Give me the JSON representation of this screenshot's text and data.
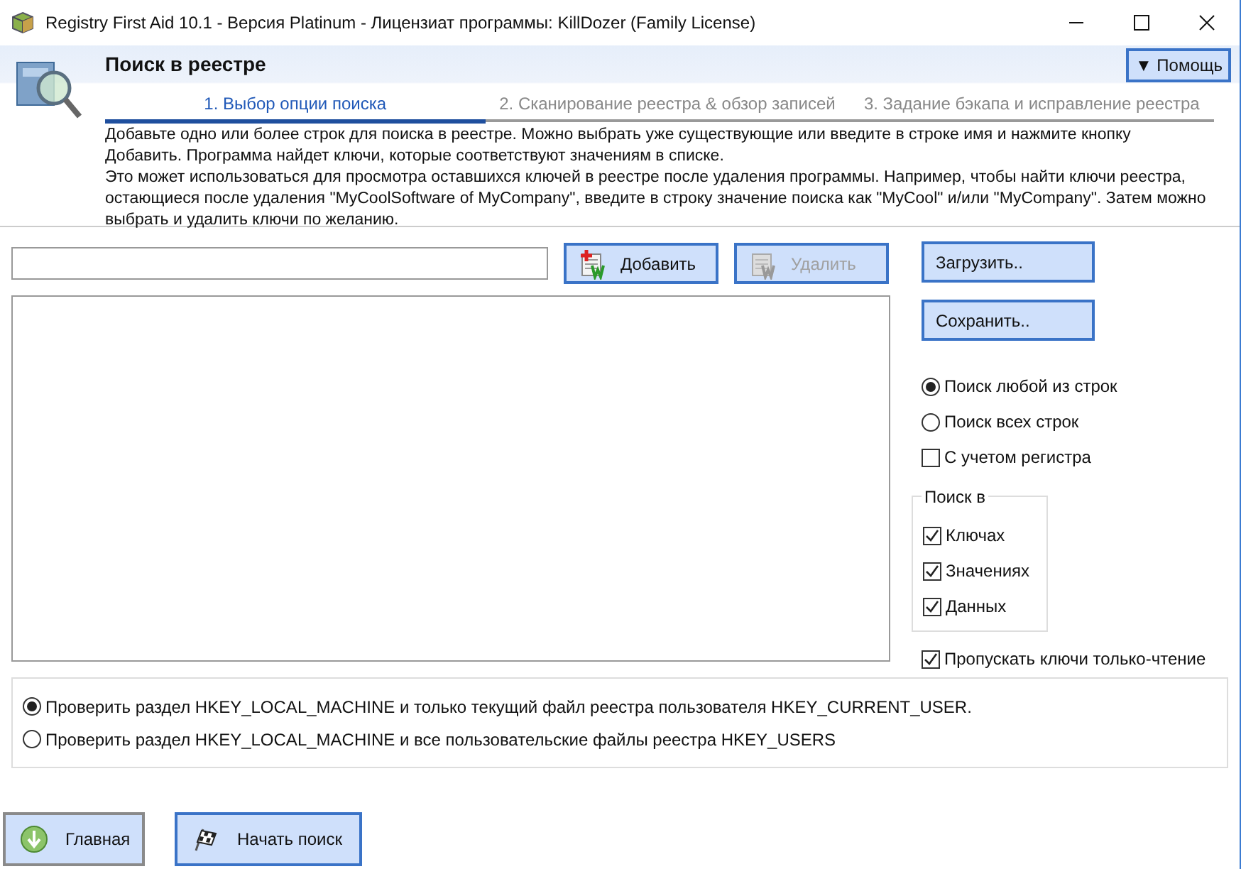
{
  "window": {
    "title": "Registry First Aid 10.1 - Версия Platinum - Лицензиат программы: KillDozer (Family License)"
  },
  "header": {
    "title": "Поиск в реестре",
    "help_button": "▼ Помощь"
  },
  "steps": [
    {
      "label": "1. Выбор опции поиска",
      "selected": true
    },
    {
      "label": "2. Сканирование реестра & обзор записей",
      "selected": false
    },
    {
      "label": "3. Задание бэкапа и исправление реестра",
      "selected": false
    }
  ],
  "description": [
    "Добавьте одно или более строк для поиска в реестре. Можно выбрать уже существующие или введите в строке имя и нажмите кнопку Добавить. Программа найдет ключи, которые соответствуют значениям в списке.",
    "Это может использоваться для просмотра оставшихся ключей в реестре после удаления программы. Например, чтобы найти ключи реестра, остающиеся после удаления \"MyCoolSoftware of MyCompany\", введите в строку значение поиска как \"MyCool\" и/или \"MyCompany\". Затем можно выбрать и удалить ключи по желанию."
  ],
  "list_buttons": [
    {
      "label": "Добавить",
      "disabled": false
    },
    {
      "label": "Удалить",
      "disabled": true
    }
  ],
  "file_buttons": [
    "Загрузить..",
    "Сохранить.."
  ],
  "match_mode": [
    {
      "label": "Поиск любой из строк",
      "selected": true
    },
    {
      "label": "Поиск всех строк",
      "selected": false
    }
  ],
  "case_sensitive": {
    "label": "С учетом регистра",
    "checked": false
  },
  "search_in": {
    "title": "Поиск в",
    "items": [
      {
        "label": "Ключах",
        "checked": true
      },
      {
        "label": "Значениях",
        "checked": true
      },
      {
        "label": "Данных",
        "checked": true
      }
    ]
  },
  "skip_readonly": {
    "label": "Пропускать ключи только-чтение",
    "checked": true
  },
  "scope": [
    {
      "label": "Проверить раздел HKEY_LOCAL_MACHINE и только текущий файл реестра пользователя HKEY_CURRENT_USER.",
      "selected": true
    },
    {
      "label": "Проверить раздел HKEY_LOCAL_MACHINE и все пользовательские файлы реестра HKEY_USERS",
      "selected": false
    }
  ],
  "footer_buttons": [
    {
      "label": "Главная",
      "kind": "home"
    },
    {
      "label": "Начать поиск",
      "kind": "start"
    }
  ]
}
